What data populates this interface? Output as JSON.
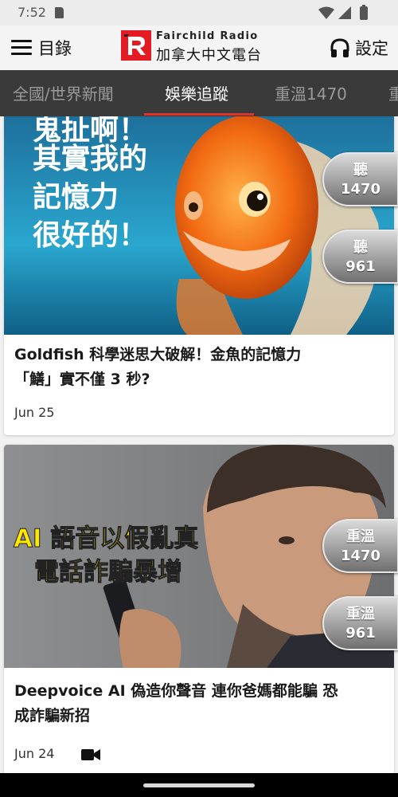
{
  "status_bar": {
    "time": "7:52",
    "icons": [
      "sim-icon",
      "wifi-icon",
      "signal-icon",
      "battery-icon"
    ]
  },
  "app_bar": {
    "menu_label": "目錄",
    "logo_en": "Fairchild Radio",
    "logo_zh": "加拿大中文電台",
    "settings_label": "設定",
    "icons": [
      "menu-icon",
      "logo-icon",
      "headphones-icon"
    ]
  },
  "tabs": [
    {
      "label": "全國/世界新聞",
      "active": false
    },
    {
      "label": "娛樂追蹤",
      "active": true
    },
    {
      "label": "重溫1470",
      "active": false
    },
    {
      "label": "重",
      "active": false
    }
  ],
  "articles": [
    {
      "image_text": [
        "鬼扯啊！",
        "其實我的",
        "記憶力",
        "很好的！"
      ],
      "title_line1": "Goldfish 科學迷思大破解！金魚的記憶力",
      "title_line2": "「鱔」實不僅 3 秒?",
      "date": "Jun 25",
      "has_video": false
    },
    {
      "image_text": [
        "AI 語音以假亂真",
        "電話詐騙暴增"
      ],
      "title_line1": "Deepvoice AI 偽造你聲音 連你爸媽都能騙  恐",
      "title_line2": "成詐騙新招",
      "date": "Jun 24",
      "has_video": true
    }
  ],
  "floating_buttons": [
    {
      "line1": "聽",
      "line2": "1470"
    },
    {
      "line1": "聽",
      "line2": "961"
    },
    {
      "line1": "重溫",
      "line2": "1470"
    },
    {
      "line1": "重溫",
      "line2": "961"
    }
  ],
  "colors": {
    "accent": "#e4322b",
    "tab_bar": "#3a3a3a",
    "logo_red": "#e31b23"
  }
}
